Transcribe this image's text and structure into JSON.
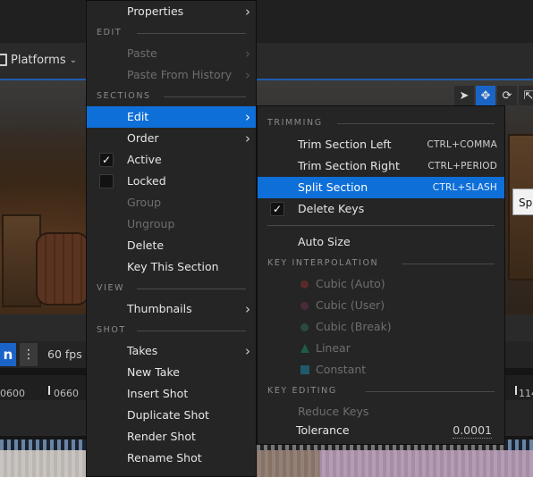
{
  "background": {
    "platforms_label": "Platforms",
    "fps_label": "60 fps",
    "logo_glyph": "n",
    "ruler_ticks": [
      "0600",
      "0660",
      "114"
    ],
    "tooltip_text": "Spl"
  },
  "context_menu": {
    "properties_label": "Properties",
    "sections": [
      {
        "key": "edit",
        "title": "EDIT"
      },
      {
        "key": "sections",
        "title": "SECTIONS"
      },
      {
        "key": "view",
        "title": "VIEW"
      },
      {
        "key": "shot",
        "title": "SHOT"
      }
    ],
    "edit_items": [
      {
        "label": "Paste",
        "enabled": false,
        "submenu": true
      },
      {
        "label": "Paste From History",
        "enabled": false,
        "submenu": true
      }
    ],
    "section_items": [
      {
        "label": "Edit",
        "submenu": true,
        "highlighted": true
      },
      {
        "label": "Order",
        "submenu": true
      },
      {
        "label": "Active",
        "checkbox": true,
        "checked": true
      },
      {
        "label": "Locked",
        "checkbox": true,
        "checked": false
      },
      {
        "label": "Group",
        "enabled": false
      },
      {
        "label": "Ungroup",
        "enabled": false
      },
      {
        "label": "Delete"
      },
      {
        "label": "Key This Section"
      }
    ],
    "view_items": [
      {
        "label": "Thumbnails",
        "submenu": true
      }
    ],
    "shot_items": [
      {
        "label": "Takes",
        "submenu": true
      },
      {
        "label": "New Take"
      },
      {
        "label": "Insert Shot"
      },
      {
        "label": "Duplicate Shot"
      },
      {
        "label": "Render Shot"
      },
      {
        "label": "Rename Shot"
      }
    ]
  },
  "edit_submenu": {
    "trimming_title": "TRIMMING",
    "trimming_items": [
      {
        "label": "Trim Section Left",
        "shortcut": "CTRL+COMMA"
      },
      {
        "label": "Trim Section Right",
        "shortcut": "CTRL+PERIOD"
      },
      {
        "label": "Split Section",
        "shortcut": "CTRL+SLASH",
        "highlighted": true
      },
      {
        "label": "Delete Keys",
        "checkbox": true,
        "checked": true
      }
    ],
    "auto_size_label": "Auto Size",
    "key_interpolation_title": "KEY INTERPOLATION",
    "interpolation_items": [
      {
        "label": "Cubic (Auto)",
        "icon": "circle",
        "color": "#5a2a2a"
      },
      {
        "label": "Cubic (User)",
        "icon": "circle",
        "color": "#4a2a3a"
      },
      {
        "label": "Cubic (Break)",
        "icon": "circle",
        "color": "#2a4a3a"
      },
      {
        "label": "Linear",
        "icon": "triangle",
        "color": "#1f5a4a"
      },
      {
        "label": "Constant",
        "icon": "square",
        "color": "#1f5a6a"
      }
    ],
    "key_editing_title": "KEY EDITING",
    "reduce_keys_label": "Reduce Keys",
    "tolerance_label": "Tolerance",
    "tolerance_value": "0.0001"
  },
  "colors": {
    "highlight": "#0e6fd8",
    "menu_bg": "#252525"
  }
}
